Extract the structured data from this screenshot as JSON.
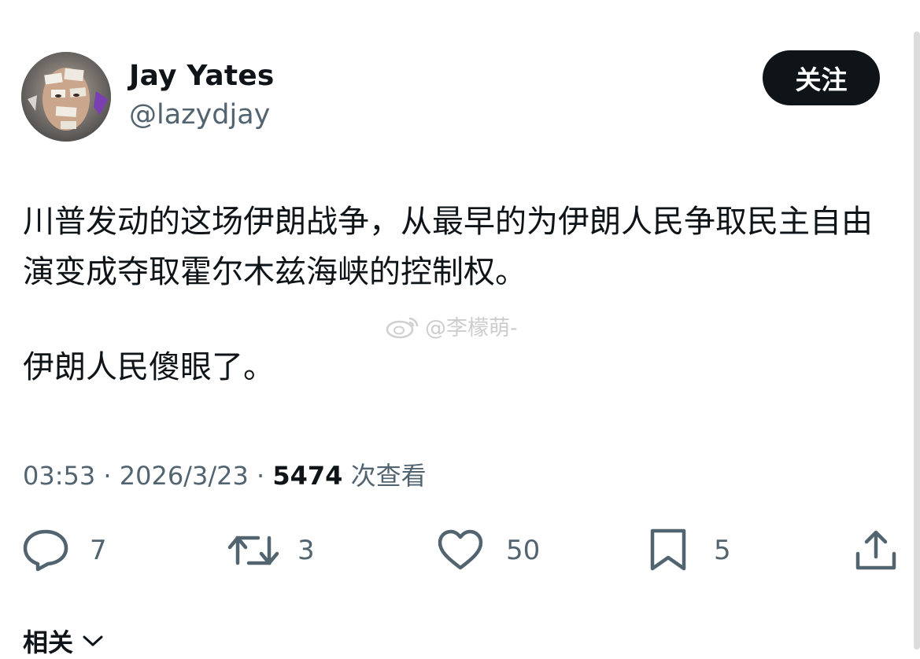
{
  "author": {
    "name": "Jay Yates",
    "handle": "@lazydjay"
  },
  "follow_label": "关注",
  "tweet": {
    "paragraph1": "川普发动的这场伊朗战争，从最早的为伊朗人民争取民主自由演变成夺取霍尔木兹海峡的控制权。",
    "paragraph2": "伊朗人民傻眼了。"
  },
  "watermark": "@李檬萌-",
  "meta": {
    "time": "03:53",
    "date": "2026/3/23",
    "views": "5474",
    "views_label": "次查看"
  },
  "actions": {
    "reply": "7",
    "retweet": "3",
    "like": "50",
    "bookmark": "5"
  },
  "related_label": "相关",
  "icons": [
    "reply-icon",
    "retweet-icon",
    "like-icon",
    "bookmark-icon",
    "share-icon",
    "chevron-down-icon",
    "weibo-icon"
  ]
}
